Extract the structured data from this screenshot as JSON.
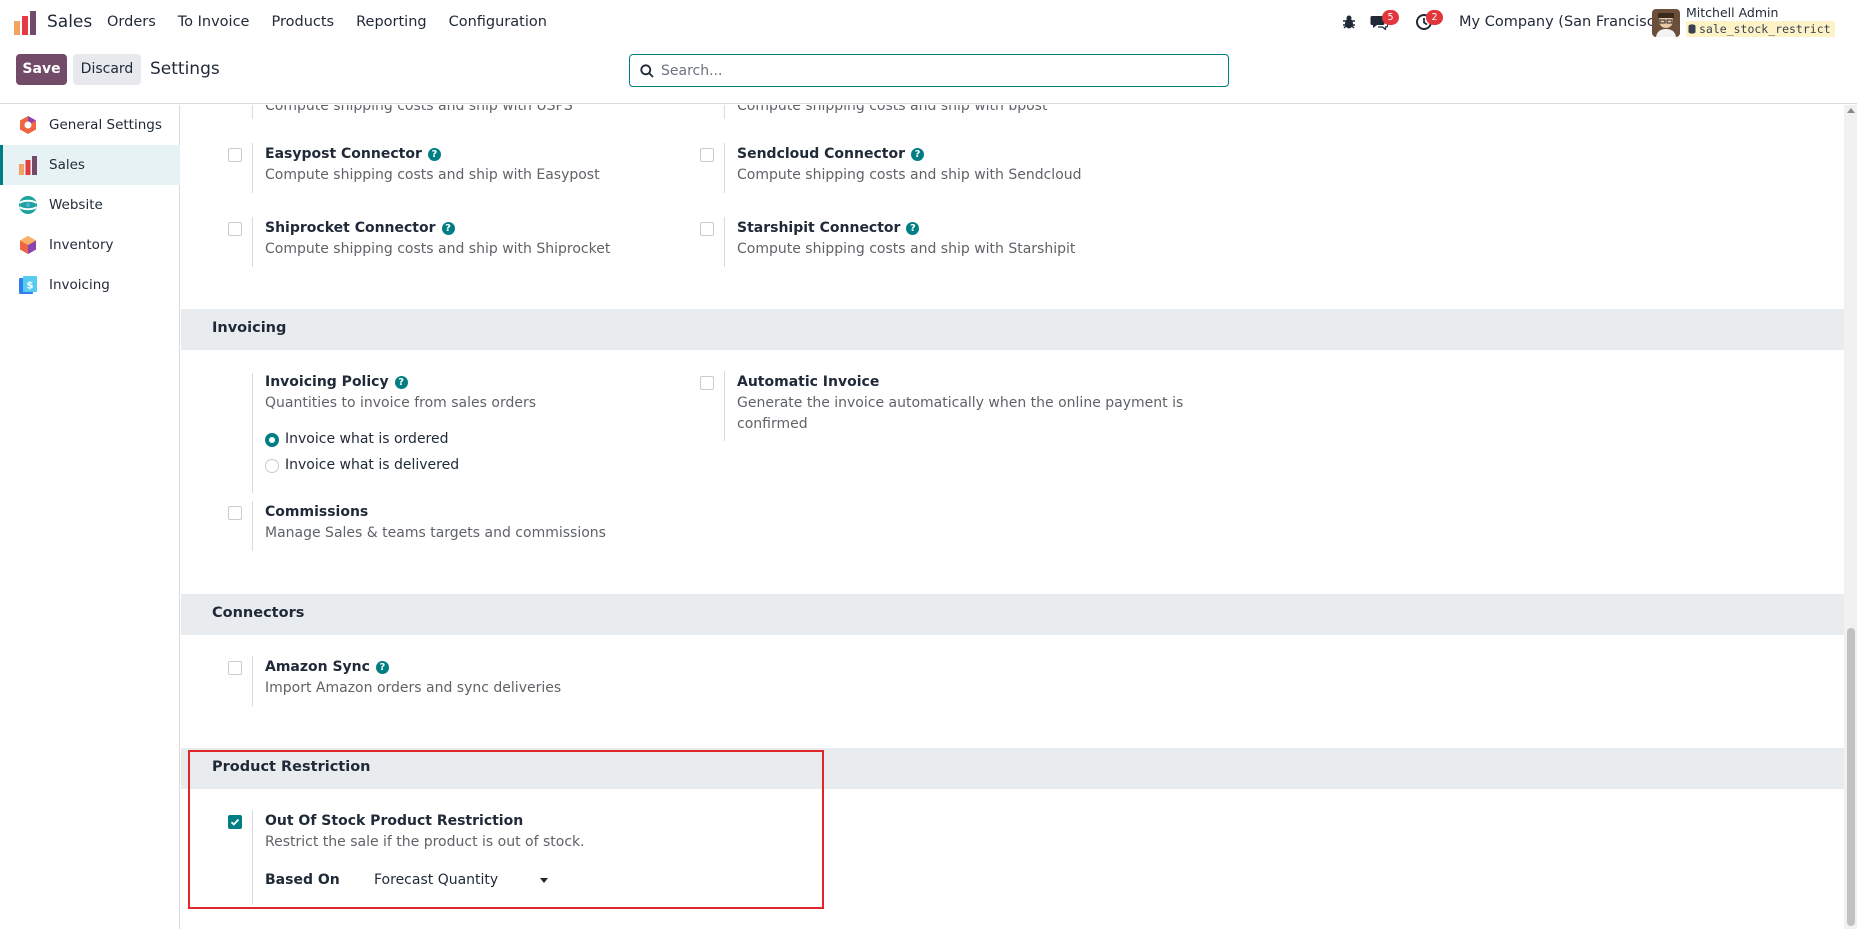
{
  "navbar": {
    "brand": "Sales",
    "menu": [
      "Orders",
      "To Invoice",
      "Products",
      "Reporting",
      "Configuration"
    ],
    "messages_badge": "5",
    "activities_badge": "2",
    "company": "My Company (San Francisco)",
    "user_name": "Mitchell Admin",
    "database": "sale_stock_restrict",
    "icons": [
      "bug-icon",
      "chat-icon",
      "clock-icon"
    ]
  },
  "control": {
    "save_label": "Save",
    "discard_label": "Discard",
    "title": "Settings",
    "search_placeholder": "Search..."
  },
  "sidebar": {
    "items": [
      {
        "label": "General Settings",
        "icon": "general-settings-icon",
        "active": false
      },
      {
        "label": "Sales",
        "icon": "sales-icon",
        "active": true
      },
      {
        "label": "Website",
        "icon": "website-icon",
        "active": false
      },
      {
        "label": "Inventory",
        "icon": "inventory-icon",
        "active": false
      },
      {
        "label": "Invoicing",
        "icon": "invoicing-icon",
        "active": false
      }
    ]
  },
  "shipping": {
    "partial_left_desc": "Compute shipping costs and ship with USPS",
    "partial_right_desc": "Compute shipping costs and ship with bpost",
    "easypost": {
      "title": "Easypost Connector",
      "desc": "Compute shipping costs and ship with Easypost",
      "checked": false
    },
    "sendcloud": {
      "title": "Sendcloud Connector",
      "desc": "Compute shipping costs and ship with Sendcloud",
      "checked": false
    },
    "shiprocket": {
      "title": "Shiprocket Connector",
      "desc": "Compute shipping costs and ship with Shiprocket",
      "checked": false
    },
    "starshipit": {
      "title": "Starshipit Connector",
      "desc": "Compute shipping costs and ship with Starshipit",
      "checked": false
    }
  },
  "invoicing": {
    "section_title": "Invoicing",
    "policy": {
      "title": "Invoicing Policy",
      "desc": "Quantities to invoice from sales orders",
      "options": [
        "Invoice what is ordered",
        "Invoice what is delivered"
      ],
      "selected": "Invoice what is ordered"
    },
    "automatic": {
      "title": "Automatic Invoice",
      "desc_line1": "Generate the invoice automatically when the online payment is",
      "desc_line2": "confirmed",
      "checked": false
    },
    "commissions": {
      "title": "Commissions",
      "desc": "Manage Sales & teams targets and commissions",
      "checked": false
    }
  },
  "connectors": {
    "section_title": "Connectors",
    "amazon": {
      "title": "Amazon Sync",
      "desc": "Import Amazon orders and sync deliveries",
      "checked": false
    }
  },
  "product_restriction": {
    "section_title": "Product Restriction",
    "title": "Out Of Stock Product Restriction",
    "desc": "Restrict the sale if the product is out of stock.",
    "checked": true,
    "based_on_label": "Based On",
    "based_on_value": "Forecast Quantity"
  },
  "colors": {
    "primary": "#714b67",
    "accent": "#017e84",
    "badge": "#e2363c",
    "highlight": "#e0262b"
  }
}
